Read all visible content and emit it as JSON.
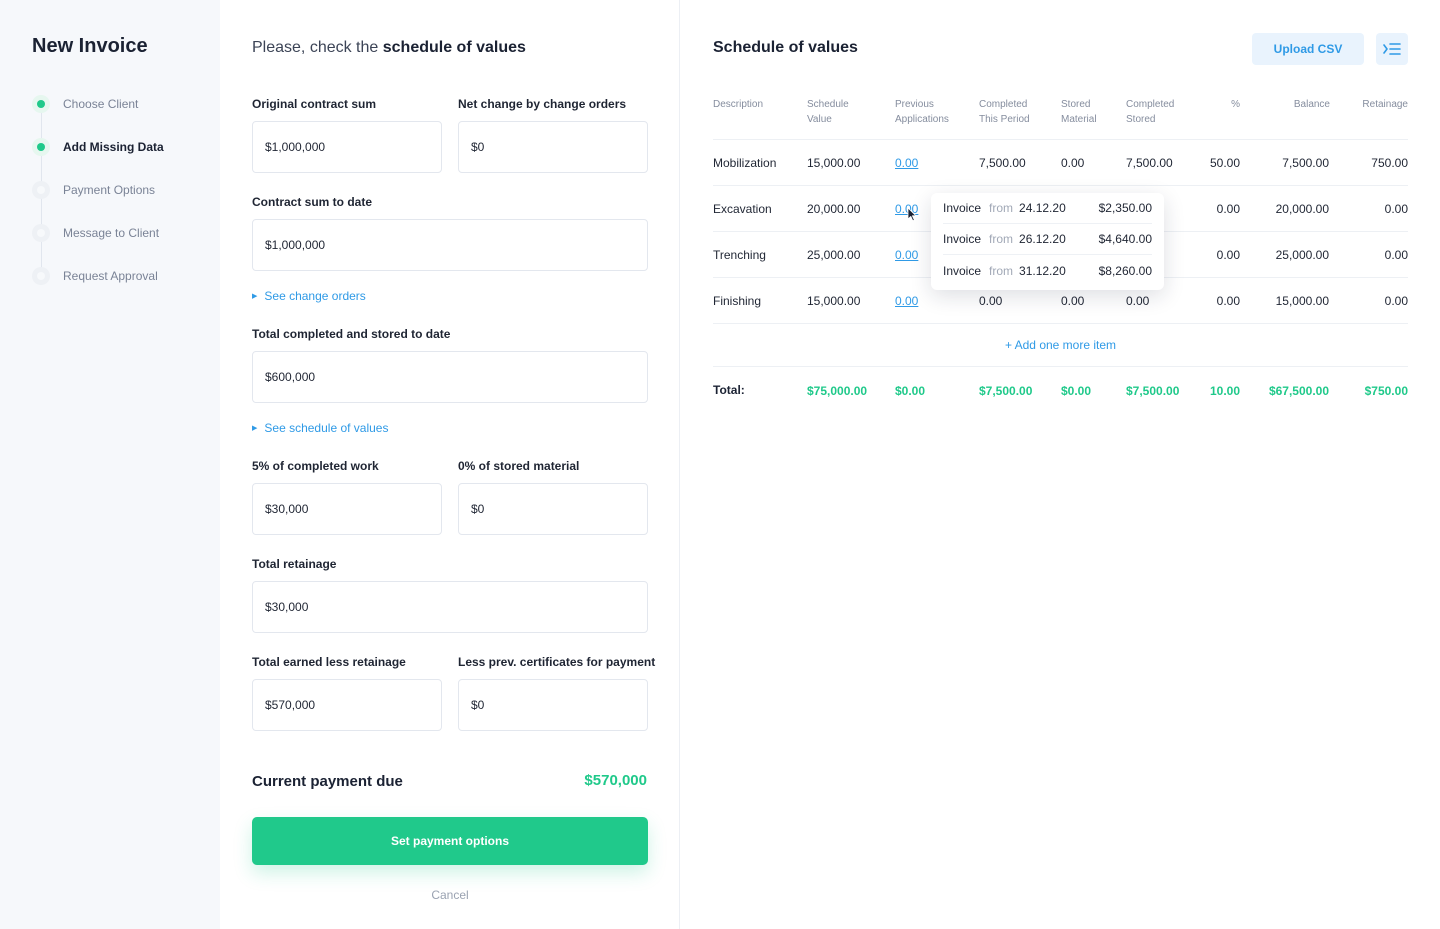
{
  "sidebar": {
    "title": "New Invoice",
    "steps": [
      {
        "label": "Choose Client",
        "state": "done"
      },
      {
        "label": "Add Missing Data",
        "state": "active"
      },
      {
        "label": "Payment Options",
        "state": "pending"
      },
      {
        "label": "Message to Client",
        "state": "pending"
      },
      {
        "label": "Request Approval",
        "state": "pending"
      }
    ]
  },
  "form": {
    "heading_prefix": "Please, check the",
    "heading_emphasis": "schedule of values",
    "original_contract_sum": {
      "label": "Original contract sum",
      "value": "$1,000,000"
    },
    "net_change": {
      "label": "Net change by change orders",
      "value": "$0"
    },
    "contract_sum_to_date": {
      "label": "Contract sum to date",
      "value": "$1,000,000"
    },
    "see_change_orders": "See change orders",
    "total_completed_stored": {
      "label": "Total completed and stored to date",
      "value": "$600,000"
    },
    "see_schedule_of_values": "See schedule of values",
    "pct_completed_work": {
      "label": "5% of completed work",
      "value": "$30,000"
    },
    "pct_stored_material": {
      "label": "0% of stored material",
      "value": "$0"
    },
    "total_retainage": {
      "label": "Total retainage",
      "value": "$30,000"
    },
    "total_earned_less_retainage": {
      "label": "Total earned less retainage",
      "value": "$570,000"
    },
    "less_prev_certificates": {
      "label": "Less prev. certificates for payment",
      "value": "$0"
    },
    "current_payment_due": {
      "label": "Current payment due",
      "value": "$570,000"
    },
    "primary_button": "Set payment options",
    "cancel": "Cancel"
  },
  "schedule": {
    "title": "Schedule of values",
    "upload_button": "Upload CSV",
    "columns": [
      {
        "line1": "Description",
        "line2": ""
      },
      {
        "line1": "Schedule",
        "line2": "Value"
      },
      {
        "line1": "Previous",
        "line2": "Applications"
      },
      {
        "line1": "Completed",
        "line2": "This Period"
      },
      {
        "line1": "Stored",
        "line2": "Material"
      },
      {
        "line1": "Completed",
        "line2": "Stored"
      },
      {
        "line1": "%",
        "line2": ""
      },
      {
        "line1": "Balance",
        "line2": ""
      },
      {
        "line1": "Retainage",
        "line2": ""
      }
    ],
    "rows": [
      {
        "description": "Mobilization",
        "schedule_value": "15,000.00",
        "previous_applications": "0.00",
        "completed_this_period": "7,500.00",
        "stored_material": "0.00",
        "completed_stored": "7,500.00",
        "percent": "50.00",
        "balance": "7,500.00",
        "retainage": "750.00"
      },
      {
        "description": "Excavation",
        "schedule_value": "20,000.00",
        "previous_applications": "0.00",
        "completed_this_period": "",
        "stored_material": "",
        "completed_stored": "",
        "percent": "0.00",
        "balance": "20,000.00",
        "retainage": "0.00"
      },
      {
        "description": "Trenching",
        "schedule_value": "25,000.00",
        "previous_applications": "0.00",
        "completed_this_period": "",
        "stored_material": "",
        "completed_stored": "",
        "percent": "0.00",
        "balance": "25,000.00",
        "retainage": "0.00"
      },
      {
        "description": "Finishing",
        "schedule_value": "15,000.00",
        "previous_applications": "0.00",
        "completed_this_period": "0.00",
        "stored_material": "0.00",
        "completed_stored": "0.00",
        "percent": "0.00",
        "balance": "15,000.00",
        "retainage": "0.00"
      }
    ],
    "add_item": "+ Add one more item",
    "totals": {
      "label": "Total:",
      "schedule_value": "$75,000.00",
      "previous_applications": "$0.00",
      "completed_this_period": "$7,500.00",
      "stored_material": "$0.00",
      "completed_stored": "$7,500.00",
      "percent": "10.00",
      "balance": "$67,500.00",
      "retainage": "$750.00"
    },
    "popover": {
      "items": [
        {
          "kind": "Invoice",
          "from": "from",
          "date": "24.12.20",
          "amount": "$2,350.00"
        },
        {
          "kind": "Invoice",
          "from": "from",
          "date": "26.12.20",
          "amount": "$4,640.00"
        },
        {
          "kind": "Invoice",
          "from": "from",
          "date": "31.12.20",
          "amount": "$8,260.00"
        }
      ]
    }
  },
  "colors": {
    "accent_green": "#20c98b",
    "link_blue": "#2f9ae6",
    "sidebar_bg": "#f6f8fb"
  },
  "icons": {
    "menu": "menu-collapse-icon",
    "toggle": "triangle-right-icon",
    "cursor": "mouse-pointer-icon"
  }
}
